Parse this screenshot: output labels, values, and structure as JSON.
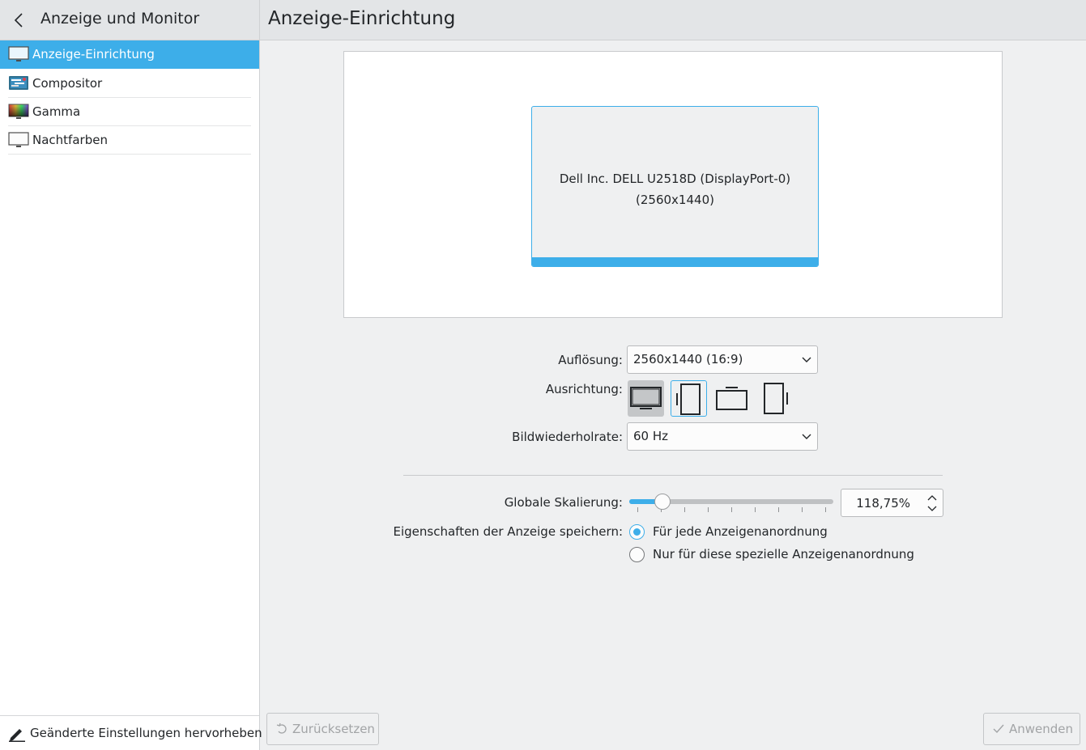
{
  "sidebar": {
    "title": "Anzeige und Monitor",
    "items": [
      {
        "label": "Anzeige-Einrichtung",
        "icon": "monitor-icon",
        "active": true
      },
      {
        "label": "Compositor",
        "icon": "compositor-icon",
        "active": false
      },
      {
        "label": "Gamma",
        "icon": "gamma-icon",
        "active": false
      },
      {
        "label": "Nachtfarben",
        "icon": "night-color-icon",
        "active": false
      }
    ],
    "highlight_label": "Geänderte Einstellungen hervorheben"
  },
  "main": {
    "title": "Anzeige-Einrichtung",
    "output": {
      "name": "Dell Inc. DELL U2518D (DisplayPort-0)",
      "mode": "(2560x1440)"
    },
    "resolution": {
      "label": "Auflösung:",
      "value": "2560x1440 (16:9)"
    },
    "orientation": {
      "label": "Ausrichtung:",
      "buttons": [
        "landscape-icon",
        "rotate-left-icon",
        "upside-down-icon",
        "rotate-right-icon"
      ],
      "selected": 0
    },
    "refresh": {
      "label": "Bildwiederholrate:",
      "value": "60 Hz"
    },
    "scale": {
      "label": "Globale Skalierung:",
      "value": "118,75%",
      "slider_fraction": 0.125
    },
    "save": {
      "label": "Eigenschaften der Anzeige speichern:",
      "option_all": "Für jede Anzeigenanordnung",
      "option_this": "Nur für diese spezielle Anzeigenanordnung",
      "selected": "all"
    }
  },
  "footer": {
    "reset_label": "Zurücksetzen",
    "apply_label": "Anwenden"
  },
  "colors": {
    "accent": "#3daee9",
    "header": "#e3e5e7",
    "window": "#eff0f1"
  }
}
